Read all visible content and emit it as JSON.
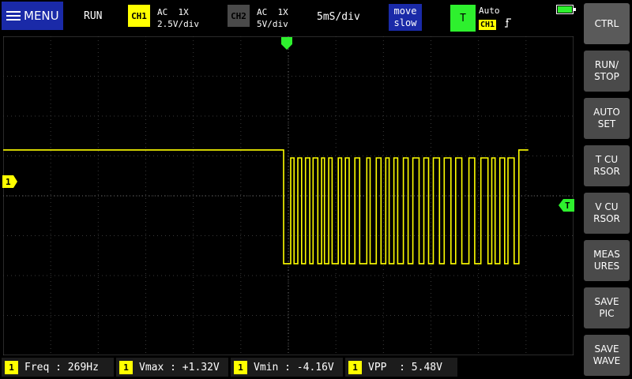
{
  "header": {
    "menu_label": "MENU",
    "run_state": "RUN",
    "ch1": {
      "tag": "CH1",
      "coupling": "AC  1X",
      "scale": "2.5V/div",
      "color": "#ffff00"
    },
    "ch2": {
      "tag": "CH2",
      "coupling": "AC  1X",
      "scale": "5V/div",
      "color": "#4a4a4a"
    },
    "timebase": "5mS/div",
    "move_speed": {
      "line1": "move",
      "line2": "slow"
    },
    "trigger": {
      "tag": "T",
      "mode": "Auto",
      "source": "CH1",
      "edge_icon": "rising-edge-icon",
      "color": "#2ef02e"
    },
    "battery_icon": "battery-icon"
  },
  "side_buttons": [
    {
      "id": "ctrl",
      "label": "CTRL"
    },
    {
      "id": "run-stop",
      "label": "RUN/\nSTOP"
    },
    {
      "id": "auto-set",
      "label": "AUTO\nSET"
    },
    {
      "id": "t-cursor",
      "label": "T CU\nRSOR"
    },
    {
      "id": "v-cursor",
      "label": "V CU\nRSOR"
    },
    {
      "id": "measures",
      "label": "MEAS\nURES"
    },
    {
      "id": "save-pic",
      "label": "SAVE\nPIC"
    },
    {
      "id": "save-wave",
      "label": "SAVE\nWAVE"
    }
  ],
  "markers": {
    "ch1": "1",
    "trigger_level": "T"
  },
  "measurements": [
    {
      "ch": "1",
      "text": "Freq : 269Hz"
    },
    {
      "ch": "1",
      "text": "Vmax : +1.32V"
    },
    {
      "ch": "1",
      "text": "Vmin : -4.16V"
    },
    {
      "ch": "1",
      "text": "VPP  : 5.48V"
    }
  ],
  "chart_data": {
    "type": "line",
    "grid": true,
    "grid_divisions": {
      "x": 12,
      "y": 8
    },
    "series": [
      {
        "color": "#ffff00",
        "x_div": [
          0,
          5.9,
          5.9,
          6.05,
          6.05,
          6.12,
          6.12,
          6.2,
          6.2,
          6.28,
          6.28,
          6.36,
          6.36,
          6.45,
          6.45,
          6.52,
          6.52,
          6.62,
          6.62,
          6.7,
          6.7,
          6.76,
          6.76,
          6.85,
          6.85,
          6.92,
          6.92,
          7.05,
          7.05,
          7.12,
          7.12,
          7.2,
          7.2,
          7.28,
          7.28,
          7.4,
          7.4,
          7.5,
          7.5,
          7.65,
          7.65,
          7.72,
          7.72,
          7.85,
          7.85,
          7.95,
          7.95,
          8.05,
          8.05,
          8.12,
          8.12,
          8.22,
          8.22,
          8.3,
          8.3,
          8.42,
          8.42,
          8.52,
          8.52,
          8.62,
          8.62,
          8.75,
          8.75,
          8.85,
          8.85,
          8.95,
          8.95,
          9.05,
          9.05,
          9.18,
          9.18,
          9.28,
          9.28,
          9.42,
          9.42,
          9.52,
          9.52,
          9.65,
          9.65,
          9.8,
          9.8,
          9.92,
          9.92,
          10.05,
          10.05,
          10.2,
          10.2,
          10.28,
          10.28,
          10.35,
          10.35,
          10.45,
          10.45,
          10.55,
          10.55,
          10.62,
          10.62,
          10.75,
          10.75,
          10.85,
          10.85,
          11.05,
          11.05,
          12
        ],
        "y_div": [
          1.15,
          1.15,
          -1.7,
          -1.7,
          0.95,
          0.95,
          -1.7,
          -1.7,
          0.95,
          0.95,
          -1.7,
          -1.7,
          0.95,
          0.95,
          -1.7,
          -1.7,
          0.95,
          0.95,
          -1.7,
          -1.7,
          0.95,
          0.95,
          -1.7,
          -1.7,
          0.95,
          0.95,
          -1.7,
          -1.7,
          0.95,
          0.95,
          -1.7,
          -1.7,
          0.95,
          0.95,
          -1.7,
          -1.7,
          0.95,
          0.95,
          -1.7,
          -1.7,
          0.95,
          0.95,
          -1.7,
          -1.7,
          0.95,
          0.95,
          -1.7,
          -1.7,
          0.95,
          0.95,
          -1.7,
          -1.7,
          0.95,
          0.95,
          -1.7,
          -1.7,
          0.95,
          0.95,
          -1.7,
          -1.7,
          0.95,
          0.95,
          -1.7,
          -1.7,
          0.95,
          0.95,
          -1.7,
          -1.7,
          0.95,
          0.95,
          -1.7,
          -1.7,
          0.95,
          0.95,
          -1.7,
          -1.7,
          0.95,
          0.95,
          -1.7,
          -1.7,
          0.95,
          0.95,
          -1.7,
          -1.7,
          0.95,
          0.95,
          -1.7,
          -1.7,
          0.95,
          0.95,
          -1.7,
          -1.7,
          0.95,
          0.95,
          -1.7,
          -1.7,
          0.95,
          0.95,
          -1.7,
          -1.7,
          1.15,
          1.15
        ]
      }
    ]
  }
}
